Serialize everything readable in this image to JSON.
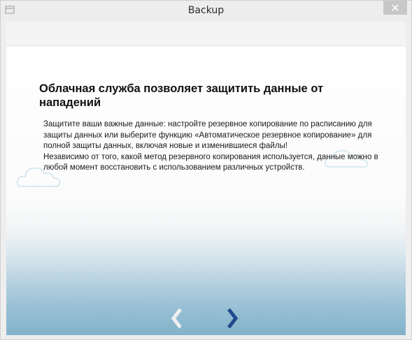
{
  "window": {
    "title": "Backup",
    "close_icon": "close-x-icon",
    "app_icon": "app-window-icon"
  },
  "main": {
    "heading": "Облачная служба позволяет защитить данные от нападений",
    "paragraphs": [
      "Защитите ваши важные данные: настройте резервное копирование по расписанию для защиты данных или выберите функцию «Автоматическое резервное копирование» для полной защиты данных, включая новые и изменившиеся файлы!",
      "Независимо от того, какой метод резервного копирования используется, данные можно в любой момент восстановить с использованием различных устройств."
    ]
  },
  "navigation": {
    "back_icon": "chevron-left-icon",
    "next_icon": "chevron-right-icon",
    "back_color": "#eef0f1",
    "next_color": "#1f4a8c"
  },
  "colors": {
    "titlebar": "#ededed",
    "close_button": "#c7c7c7",
    "sky_bottom": "#82b2c9"
  }
}
